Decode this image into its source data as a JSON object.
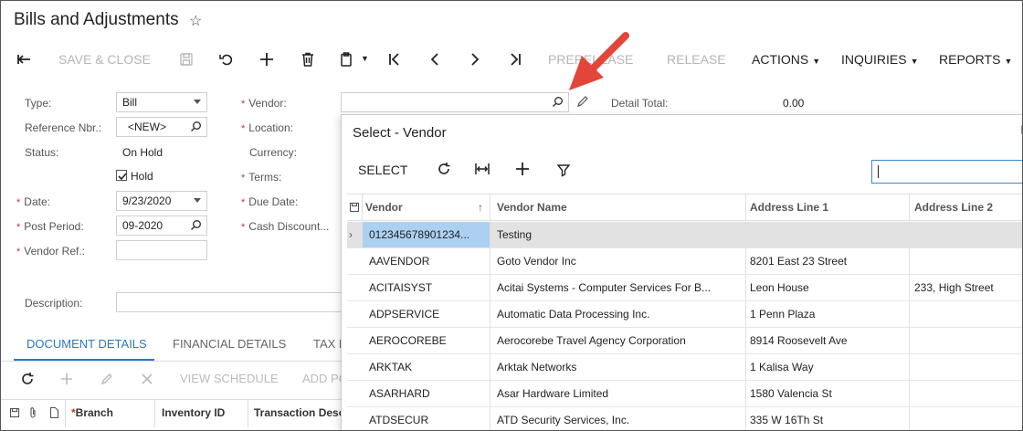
{
  "header": {
    "title": "Bills and Adjustments"
  },
  "toolbar": {
    "save_close": "SAVE & CLOSE",
    "prerelease": "PRERELEASE",
    "release": "RELEASE",
    "actions": "ACTIONS",
    "inquiries": "INQUIRIES",
    "reports": "REPORTS"
  },
  "form": {
    "type_label": "Type:",
    "type_value": "Bill",
    "refnbr_label": "Reference Nbr.:",
    "refnbr_value": "<NEW>",
    "status_label": "Status:",
    "status_value": "On Hold",
    "hold_label": "Hold",
    "date_label": "Date:",
    "date_value": "9/23/2020",
    "period_label": "Post Period:",
    "period_value": "09-2020",
    "vendorref_label": "Vendor Ref.:",
    "vendor_label": "Vendor:",
    "location_label": "Location:",
    "currency_label": "Currency:",
    "terms_label": "Terms:",
    "duedate_label": "Due Date:",
    "cashdisc_label": "Cash Discount...",
    "detailtotal_label": "Detail Total:",
    "detailtotal_value": "0.00",
    "description_label": "Description:"
  },
  "tabs": {
    "document_details": "DOCUMENT DETAILS",
    "financial_details": "FINANCIAL DETAILS",
    "tax": "TAX D"
  },
  "grid_toolbar": {
    "view_schedule": "VIEW SCHEDULE",
    "add_po": "ADD PO"
  },
  "grid_headers": {
    "branch": "Branch",
    "inventory_id": "Inventory ID",
    "transaction_desc": "Transaction Desc"
  },
  "popup": {
    "title": "Select - Vendor",
    "select": "SELECT",
    "columns": [
      "Vendor",
      "Vendor Name",
      "Address Line 1",
      "Address Line 2"
    ],
    "rows": [
      {
        "code": "012345678901234...",
        "name": "Testing",
        "addr1": "",
        "addr2": ""
      },
      {
        "code": "AAVENDOR",
        "name": "Goto Vendor Inc",
        "addr1": "8201 East 23 Street",
        "addr2": ""
      },
      {
        "code": "ACITAISYST",
        "name": "Acitai Systems - Computer Services For B...",
        "addr1": "Leon House",
        "addr2": "233, High Street"
      },
      {
        "code": "ADPSERVICE",
        "name": "Automatic Data Processing Inc.",
        "addr1": "1 Penn Plaza",
        "addr2": ""
      },
      {
        "code": "AEROCOREBE",
        "name": "Aerocorebe Travel Agency Corporation",
        "addr1": "8914 Roosevelt Ave",
        "addr2": ""
      },
      {
        "code": "ARKTAK",
        "name": "Arktak Networks",
        "addr1": "1 Kalisa Way",
        "addr2": ""
      },
      {
        "code": "ASARHARD",
        "name": "Asar Hardware Limited",
        "addr1": "1580 Valencia St",
        "addr2": ""
      },
      {
        "code": "ATDSECUR",
        "name": "ATD Security Services, Inc.",
        "addr1": "335 W 16Th St",
        "addr2": ""
      }
    ]
  },
  "colors": {
    "accent": "#2a78c2",
    "arrow": "#e2453a",
    "selection": "#acd0f1"
  }
}
